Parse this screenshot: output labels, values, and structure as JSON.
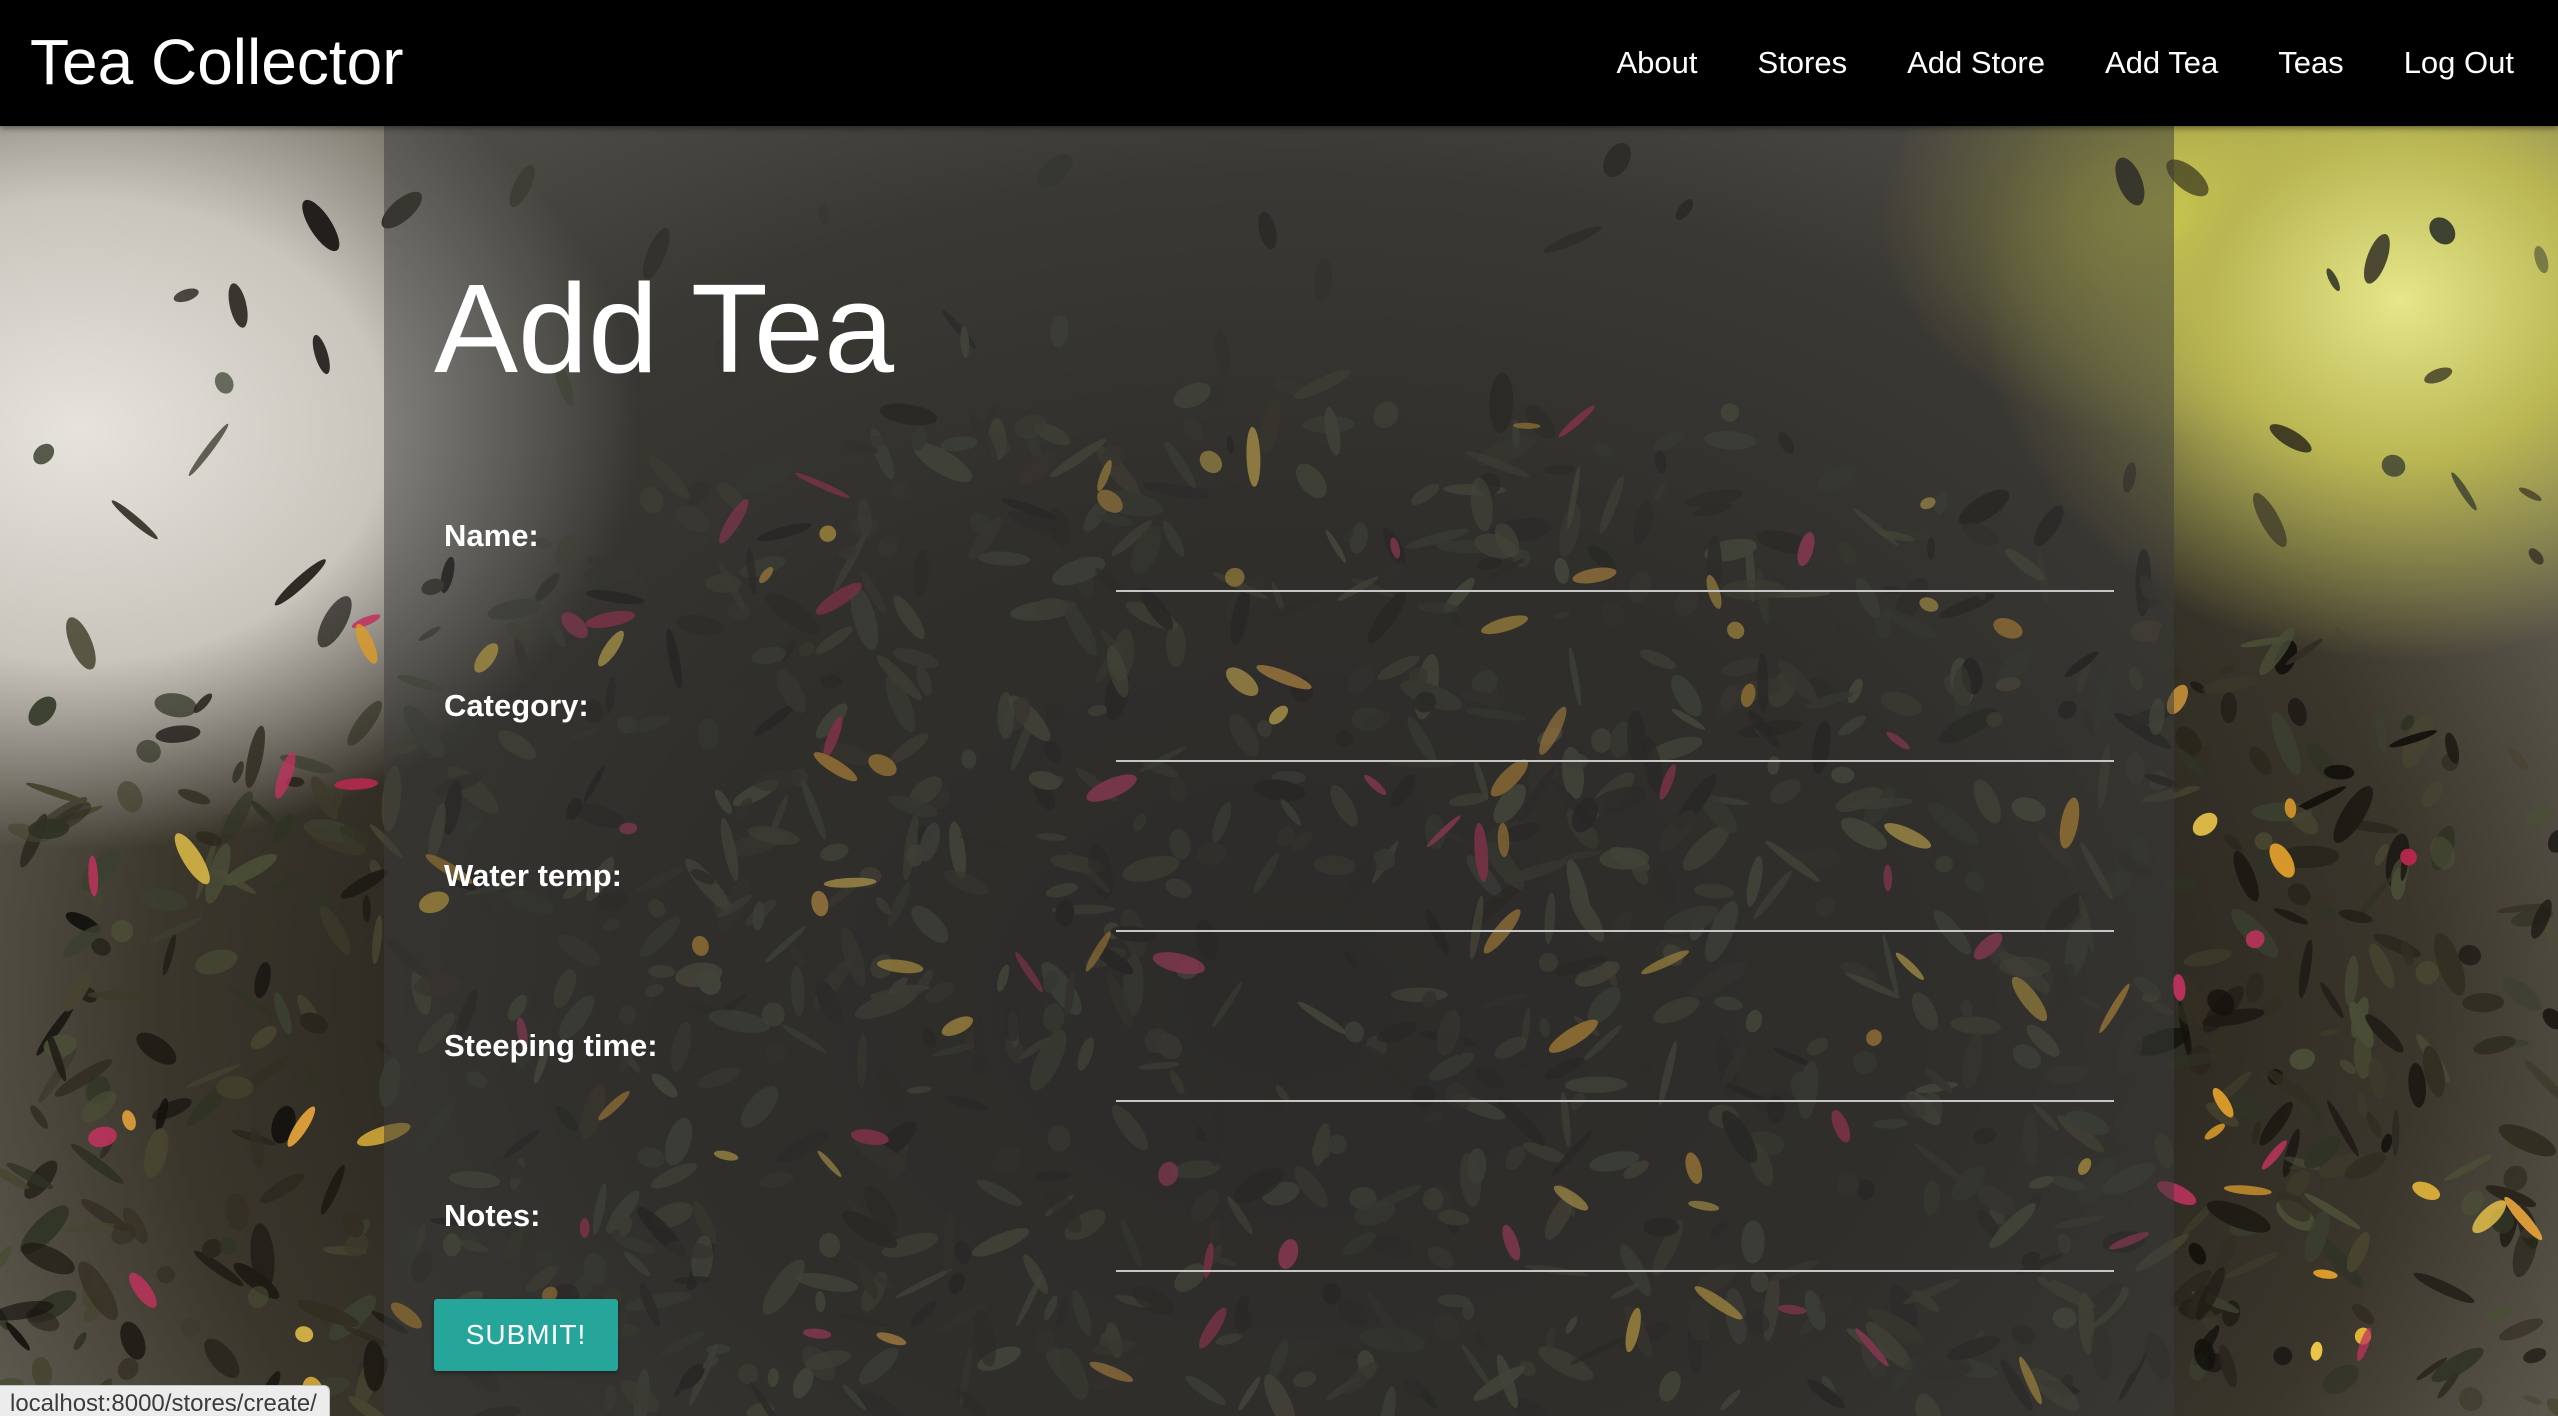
{
  "navbar": {
    "brand": "Tea Collector",
    "links": [
      "About",
      "Stores",
      "Add Store",
      "Add Tea",
      "Teas",
      "Log Out"
    ]
  },
  "page": {
    "title": "Add Tea"
  },
  "form": {
    "fields": [
      {
        "label": "Name:",
        "value": ""
      },
      {
        "label": "Category:",
        "value": ""
      },
      {
        "label": "Water temp:",
        "value": ""
      },
      {
        "label": "Steeping time:",
        "value": ""
      },
      {
        "label": "Notes:",
        "value": ""
      }
    ],
    "submit_label": "SUBMIT!"
  },
  "status_bar": {
    "url": "localhost:8000/stores/create/"
  },
  "colors": {
    "navbar": "#000000",
    "accent": "#26a69a",
    "panel_overlay": "rgba(60,60,60,0.52)"
  }
}
